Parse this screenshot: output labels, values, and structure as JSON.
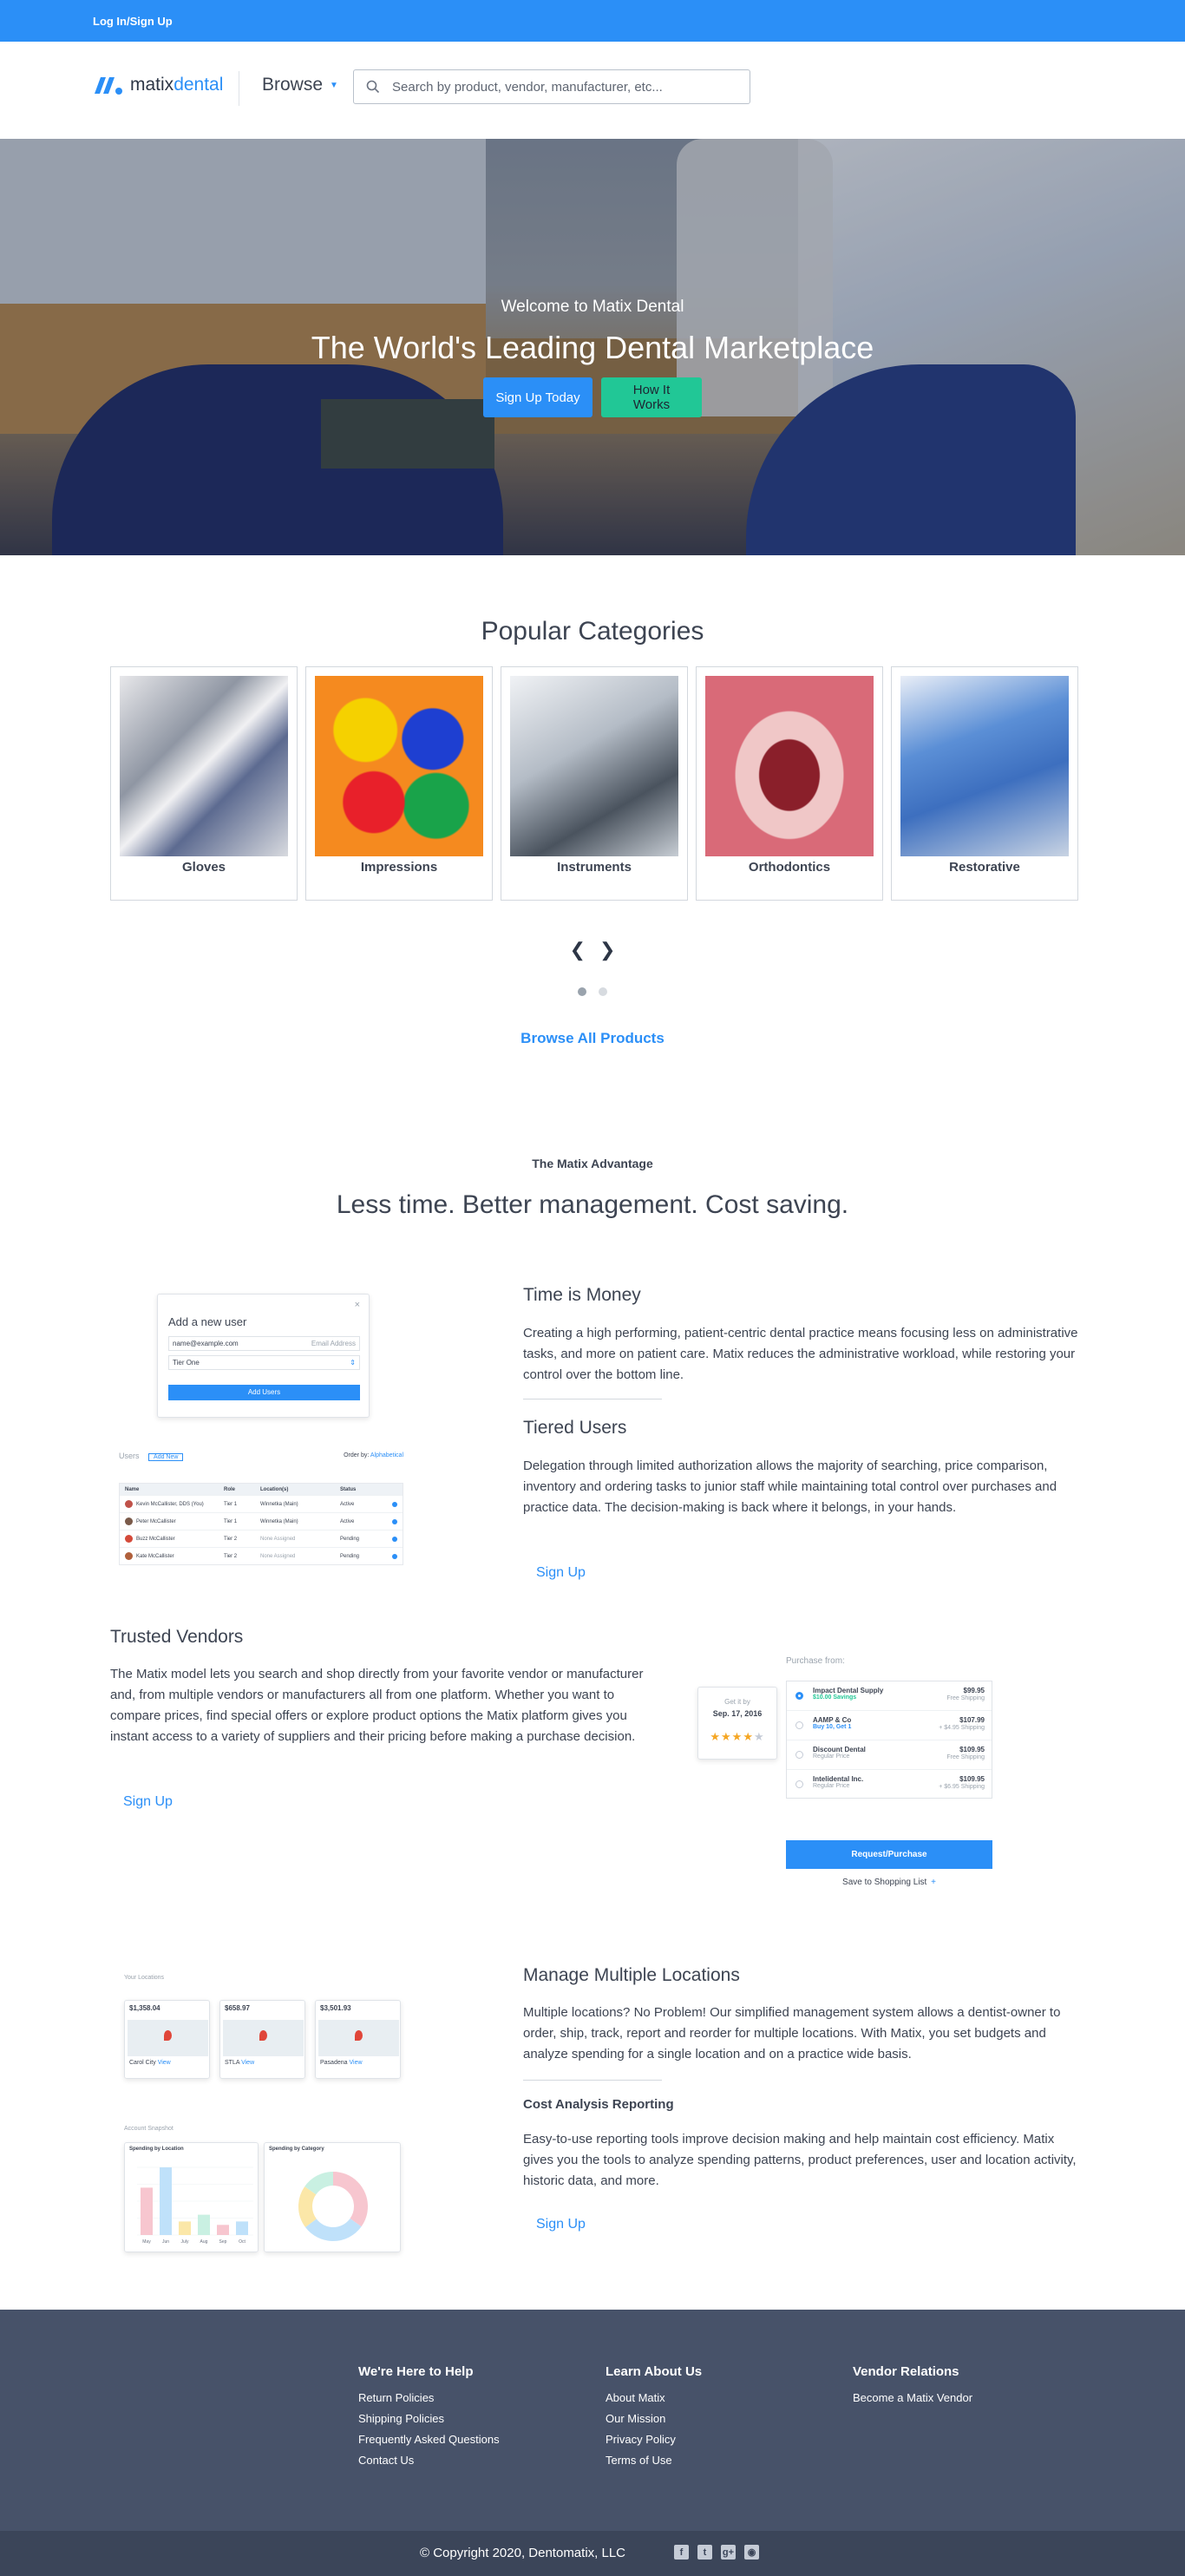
{
  "topbar": {
    "login_label": "Log In/Sign Up"
  },
  "header": {
    "logo_word_matix": "matix",
    "logo_word_dental": "dental",
    "browse_label": "Browse",
    "search_placeholder": "Search by product, vendor, manufacturer, etc..."
  },
  "hero": {
    "welcome": "Welcome to Matix Dental",
    "headline": "The World's Leading Dental Marketplace",
    "signup_label": "Sign Up Today",
    "how_label": "How It Works"
  },
  "categories": {
    "title": "Popular Categories",
    "items": [
      {
        "label": "Gloves"
      },
      {
        "label": "Impressions"
      },
      {
        "label": "Instruments"
      },
      {
        "label": "Orthodontics"
      },
      {
        "label": "Restorative"
      }
    ],
    "prev_arrow": "❮",
    "next_arrow": "❯",
    "browse_all": "Browse All Products"
  },
  "advantage": {
    "eyebrow": "The Matix Advantage",
    "title": "Less time. Better management. Cost saving."
  },
  "features": {
    "time": {
      "title": "Time is Money",
      "body": "Creating a high performing, patient-centric dental practice means focusing less on administrative tasks, and more on patient care. Matix reduces the administrative workload, while restoring your control over the bottom line."
    },
    "tiered": {
      "title": "Tiered Users",
      "body": "Delegation through limited authorization allows the majority of searching, price comparison, inventory and ordering tasks to junior staff while maintaining total control over purchases and practice data. The decision-making is back where it belongs, in your hands.",
      "signup": "Sign Up"
    },
    "vendors": {
      "title": "Trusted Vendors",
      "body": "The Matix model lets you search and shop directly from your favorite vendor or manufacturer and, from multiple vendors or manufacturers all from one platform. Whether you want to compare prices, find special offers or explore product options the Matix platform gives you instant access to a variety of suppliers and their pricing before making a purchase decision.",
      "signup": "Sign Up"
    },
    "locations": {
      "title": "Manage Multiple Locations",
      "body": "Multiple locations? No Problem! Our simplified management system allows a dentist-owner to order, ship, track, report and reorder for multiple locations. With Matix, you set budgets and analyze spending for a single location and on a practice wide basis."
    },
    "cost": {
      "title": "Cost Analysis Reporting",
      "body": "Easy-to-use reporting tools improve decision making and help maintain cost efficiency. Matix gives you the tools to analyze spending patterns, product preferences, user and location activity, historic data, and more.",
      "signup": "Sign Up"
    }
  },
  "mock_add_user": {
    "title": "Add a new user",
    "close": "×",
    "email_value": "name@example.com",
    "email_hint": "Email Address",
    "tier_value": "Tier One",
    "button": "Add Users"
  },
  "mock_users_table": {
    "label": "Users",
    "add_new": "Add New",
    "order_by": "Order by:",
    "order_value": "Alphabetical",
    "headers": [
      "Name",
      "Role",
      "Location(s)",
      "Status"
    ],
    "rows": [
      {
        "name": "Kevin McCallister, DDS (You)",
        "role": "Tier 1",
        "loc": "Winnetka (Main)",
        "status": "Active"
      },
      {
        "name": "Peter McCallister",
        "role": "Tier 1",
        "loc": "Winnetka (Main)",
        "status": "Active"
      },
      {
        "name": "Buzz McCallister",
        "role": "Tier 2",
        "loc": "None Assigned",
        "status": "Pending"
      },
      {
        "name": "Kate McCallister",
        "role": "Tier 2",
        "loc": "None Assigned",
        "status": "Pending"
      }
    ]
  },
  "mock_purchase": {
    "purchase_from": "Purchase from:",
    "get_it_by": "Get it by",
    "date": "Sep. 17, 2016",
    "vendors": [
      {
        "name": "Impact Dental Supply",
        "note": "$10.00 Savings",
        "price": "$99.95",
        "ship": "Free Shipping"
      },
      {
        "name": "AAMP & Co",
        "note": "Buy 10, Get 1",
        "price": "$107.99",
        "ship": "+ $4.95 Shipping"
      },
      {
        "name": "Discount Dental",
        "note": "Regular Price",
        "price": "$109.95",
        "ship": "Free Shipping"
      },
      {
        "name": "Intelidental Inc.",
        "note": "Regular Price",
        "price": "$109.95",
        "ship": "+ $6.95 Shipping"
      }
    ],
    "button": "Request/Purchase",
    "save": "Save to Shopping List",
    "save_plus": "+"
  },
  "mock_locations": {
    "your_locations": "Your Locations",
    "cards": [
      {
        "amount": "$1,358.04",
        "name": "Carol City",
        "view": "View"
      },
      {
        "amount": "$658.97",
        "name": "STLA",
        "view": "View"
      },
      {
        "amount": "$3,501.93",
        "name": "Pasadena",
        "view": "View"
      }
    ],
    "account_snapshot": "Account Snapshot",
    "by_location": "Spending by Location",
    "by_category": "Spending by Category",
    "bar_categories": [
      "May",
      "Jun",
      "July",
      "Aug",
      "Sep",
      "Oct"
    ],
    "bar_values": [
      70,
      100,
      20,
      30,
      15,
      20
    ],
    "colors": {
      "bar_a": "#f7c6cf",
      "bar_b": "#bfe1fa",
      "bar_c": "#fbe7a8",
      "bar_d": "#c9f0e2"
    }
  },
  "footer": {
    "help_title": "We're Here to Help",
    "help_links": [
      "Return Policies",
      "Shipping Policies",
      "Frequently Asked Questions",
      "Contact Us"
    ],
    "learn_title": "Learn About Us",
    "learn_links": [
      "About Matix",
      "Our Mission",
      "Privacy Policy",
      "Terms of Use"
    ],
    "vendor_title": "Vendor Relations",
    "vendor_links": [
      "Become a Matix Vendor"
    ],
    "copyright": "© Copyright 2020, Dentomatix, LLC",
    "social": [
      "f",
      "t",
      "g+",
      "rss"
    ]
  },
  "colors": {
    "brand_blue": "#2b8ff7",
    "green": "#21c796",
    "footer": "#475269"
  }
}
